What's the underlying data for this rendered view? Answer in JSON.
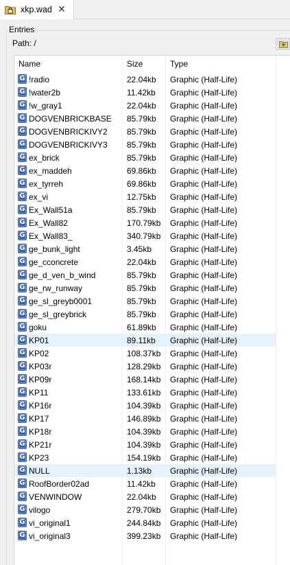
{
  "tab": {
    "title": "xkp.wad",
    "close_glyph": "✕",
    "icon": "lock-folder-icon"
  },
  "group": {
    "label": "Entries"
  },
  "path": {
    "label": "Path: /",
    "button_icon": "folder-up-icon"
  },
  "table": {
    "columns": [
      "Name",
      "Size",
      "Type"
    ],
    "rows": [
      {
        "name": "!radio",
        "size": "22.04kb",
        "type": "Graphic (Half-Life)"
      },
      {
        "name": "!water2b",
        "size": "11.42kb",
        "type": "Graphic (Half-Life)"
      },
      {
        "name": "!w_gray1",
        "size": "22.04kb",
        "type": "Graphic (Half-Life)"
      },
      {
        "name": "DOGVENBRICKBASE",
        "size": "85.79kb",
        "type": "Graphic (Half-Life)"
      },
      {
        "name": "DOGVENBRICKIVY2",
        "size": "85.79kb",
        "type": "Graphic (Half-Life)"
      },
      {
        "name": "DOGVENBRICKIVY3",
        "size": "85.79kb",
        "type": "Graphic (Half-Life)"
      },
      {
        "name": "ex_brick",
        "size": "85.79kb",
        "type": "Graphic (Half-Life)"
      },
      {
        "name": "ex_maddeh",
        "size": "69.86kb",
        "type": "Graphic (Half-Life)"
      },
      {
        "name": "ex_tyrreh",
        "size": "69.86kb",
        "type": "Graphic (Half-Life)"
      },
      {
        "name": "ex_vi",
        "size": "12.75kb",
        "type": "Graphic (Half-Life)"
      },
      {
        "name": "Ex_Wall51a",
        "size": "85.79kb",
        "type": "Graphic (Half-Life)"
      },
      {
        "name": "Ex_Wall82",
        "size": "170.79kb",
        "type": "Graphic (Half-Life)"
      },
      {
        "name": "Ex_Wall83_",
        "size": "340.79kb",
        "type": "Graphic (Half-Life)"
      },
      {
        "name": "ge_bunk_light",
        "size": "3.45kb",
        "type": "Graphic (Half-Life)"
      },
      {
        "name": "ge_cconcrete",
        "size": "22.04kb",
        "type": "Graphic (Half-Life)"
      },
      {
        "name": "ge_d_ven_b_wind",
        "size": "85.79kb",
        "type": "Graphic (Half-Life)"
      },
      {
        "name": "ge_rw_runway",
        "size": "85.79kb",
        "type": "Graphic (Half-Life)"
      },
      {
        "name": "ge_sl_greyb0001",
        "size": "85.79kb",
        "type": "Graphic (Half-Life)"
      },
      {
        "name": "ge_sl_greybrick",
        "size": "85.79kb",
        "type": "Graphic (Half-Life)"
      },
      {
        "name": "goku",
        "size": "61.89kb",
        "type": "Graphic (Half-Life)"
      },
      {
        "name": "KP01",
        "size": "89.11kb",
        "type": "Graphic (Half-Life)",
        "selected": true
      },
      {
        "name": "KP02",
        "size": "108.37kb",
        "type": "Graphic (Half-Life)"
      },
      {
        "name": "KP03r",
        "size": "128.29kb",
        "type": "Graphic (Half-Life)"
      },
      {
        "name": "KP09r",
        "size": "168.14kb",
        "type": "Graphic (Half-Life)"
      },
      {
        "name": "KP11",
        "size": "133.61kb",
        "type": "Graphic (Half-Life)"
      },
      {
        "name": "KP16r",
        "size": "104.39kb",
        "type": "Graphic (Half-Life)"
      },
      {
        "name": "KP17",
        "size": "146.89kb",
        "type": "Graphic (Half-Life)"
      },
      {
        "name": "KP18r",
        "size": "104.39kb",
        "type": "Graphic (Half-Life)"
      },
      {
        "name": "KP21r",
        "size": "104.39kb",
        "type": "Graphic (Half-Life)"
      },
      {
        "name": "KP23",
        "size": "154.19kb",
        "type": "Graphic (Half-Life)"
      },
      {
        "name": "NULL",
        "size": "1.13kb",
        "type": "Graphic (Half-Life)",
        "selected": true
      },
      {
        "name": "RoofBorder02ad",
        "size": "11.42kb",
        "type": "Graphic (Half-Life)"
      },
      {
        "name": "VENWINDOW",
        "size": "22.04kb",
        "type": "Graphic (Half-Life)"
      },
      {
        "name": "vilogo",
        "size": "279.70kb",
        "type": "Graphic (Half-Life)"
      },
      {
        "name": "vi_original1",
        "size": "244.84kb",
        "type": "Graphic (Half-Life)"
      },
      {
        "name": "vi_original3",
        "size": "399.23kb",
        "type": "Graphic (Half-Life)"
      }
    ],
    "row_icon": "graphic-entry-icon",
    "icon_letter": "G"
  },
  "colors": {
    "selection": "#e5f1fb",
    "icon_blue": "#3c5f9a"
  }
}
